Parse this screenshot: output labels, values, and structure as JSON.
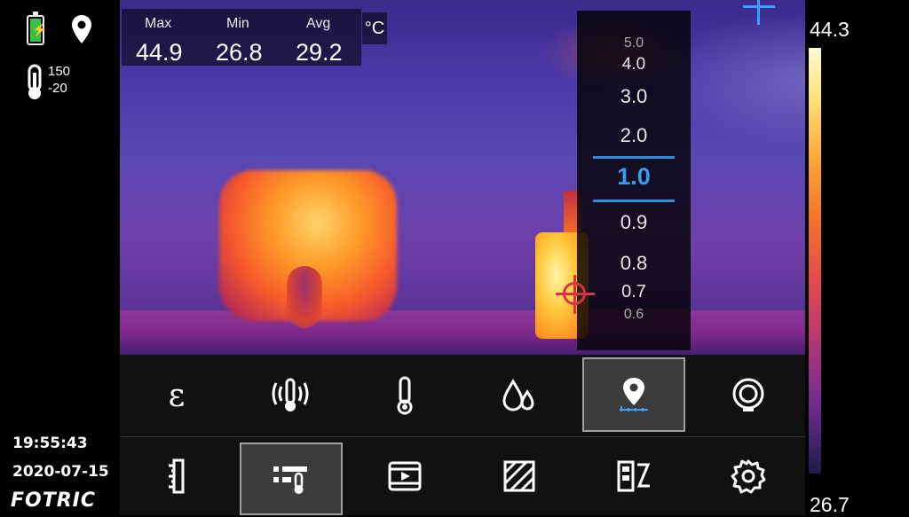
{
  "stats": {
    "max_label": "Max",
    "max_value": "44.9",
    "min_label": "Min",
    "min_value": "26.8",
    "avg_label": "Avg",
    "avg_value": "29.2",
    "unit": "°C"
  },
  "status": {
    "range_high": "150",
    "range_low": "-20",
    "time": "19:55:43",
    "date": "2020-07-15",
    "brand": "FOTRIC",
    "battery_charging": true
  },
  "emissivity_scale": {
    "values": [
      "5.0",
      "4.0",
      "3.0",
      "2.0",
      "1.0",
      "0.9",
      "0.8",
      "0.7",
      "0.6"
    ],
    "selected": "1.0",
    "accent": "#2b8ee0"
  },
  "palette": {
    "high": "44.3",
    "low": "26.7"
  },
  "toolbar_row1": [
    {
      "icon": "epsilon-icon",
      "glyph": "ε"
    },
    {
      "icon": "thermometer-signal-icon"
    },
    {
      "icon": "thermometer-icon"
    },
    {
      "icon": "humidity-drops-icon"
    },
    {
      "icon": "location-distance-icon",
      "selected": true
    },
    {
      "icon": "reflected-temp-icon"
    }
  ],
  "toolbar_row2": [
    {
      "icon": "ruler-icon"
    },
    {
      "icon": "temperature-settings-icon",
      "selected": true
    },
    {
      "icon": "video-play-icon"
    },
    {
      "icon": "area-hatch-icon"
    },
    {
      "icon": "edit-palette-icon"
    },
    {
      "icon": "settings-gear-icon"
    }
  ],
  "colors": {
    "crosshair": "#d6334a",
    "selection_blue": "#2b8ee0"
  }
}
